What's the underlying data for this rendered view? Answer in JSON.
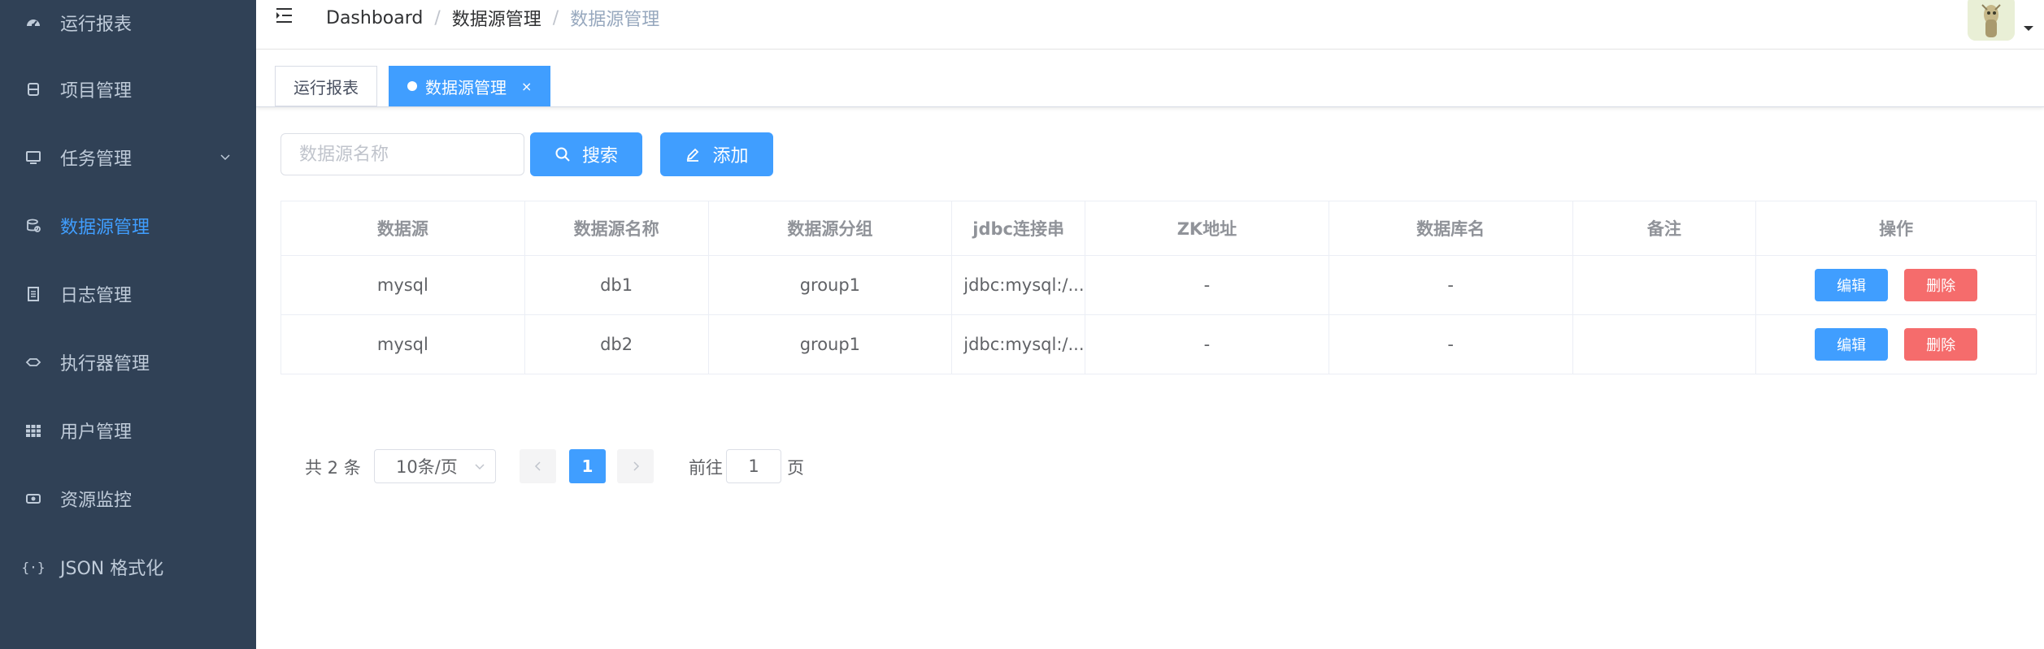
{
  "sidebar": {
    "items": [
      {
        "label": "运行报表",
        "icon": "dashboard-icon"
      },
      {
        "label": "项目管理",
        "icon": "database-icon"
      },
      {
        "label": "任务管理",
        "icon": "monitor-icon",
        "has_children": true
      },
      {
        "label": "数据源管理",
        "icon": "datasource-icon",
        "active": true
      },
      {
        "label": "日志管理",
        "icon": "document-icon"
      },
      {
        "label": "执行器管理",
        "icon": "executor-icon"
      },
      {
        "label": "用户管理",
        "icon": "grid-icon"
      },
      {
        "label": "资源监控",
        "icon": "monitor-resource-icon"
      },
      {
        "label": "JSON 格式化",
        "icon": "braces-icon"
      }
    ]
  },
  "navbar": {
    "breadcrumb": [
      "Dashboard",
      "数据源管理",
      "数据源管理"
    ],
    "separator": "/"
  },
  "tags": {
    "items": [
      {
        "label": "运行报表",
        "active": false
      },
      {
        "label": "数据源管理",
        "active": true,
        "close": "×"
      }
    ]
  },
  "filter": {
    "placeholder": "数据源名称",
    "search_label": "搜索",
    "add_label": "添加"
  },
  "table": {
    "columns": [
      "数据源",
      "数据源名称",
      "数据源分组",
      "jdbc连接串",
      "ZK地址",
      "数据库名",
      "备注",
      "操作"
    ],
    "rows": [
      [
        "mysql",
        "db1",
        "group1",
        "jdbc:mysql:/...",
        "-",
        "-",
        ""
      ],
      [
        "mysql",
        "db2",
        "group1",
        "jdbc:mysql:/...",
        "-",
        "-",
        ""
      ]
    ],
    "actions": {
      "edit": "编辑",
      "delete": "删除"
    }
  },
  "pagination": {
    "total_text": "共 2 条",
    "page_size": "10条/页",
    "current_page": "1",
    "jump_prefix": "前往",
    "jump_value": "1",
    "jump_suffix": "页"
  },
  "colors": {
    "sidebar_bg": "#304156",
    "sidebar_text": "#bfcbd9",
    "primary": "#409eff",
    "danger": "#f56c6c"
  }
}
